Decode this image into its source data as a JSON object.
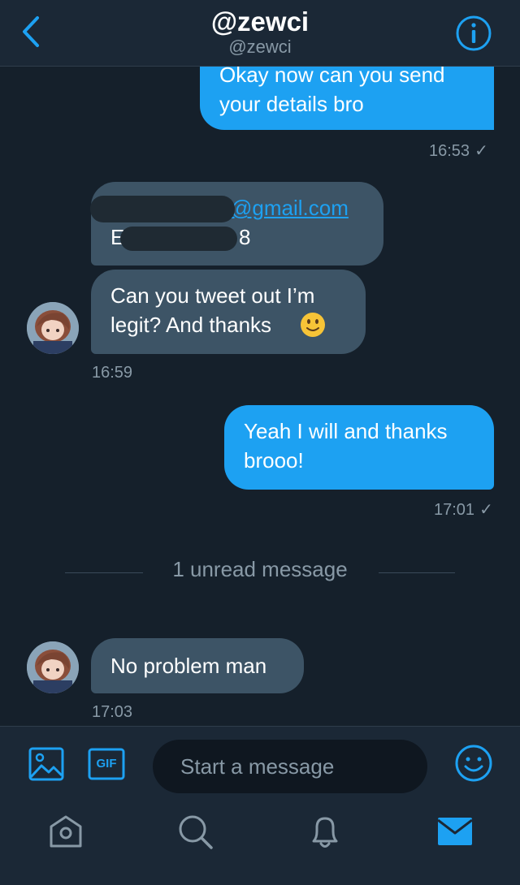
{
  "header": {
    "title": "@zewci",
    "subtitle": "@zewci",
    "back_icon": "chevron-left-icon",
    "info_icon": "info-icon"
  },
  "messages": {
    "m1": {
      "lines": [
        "Okay now can you send",
        "your details bro"
      ],
      "time": "16:53",
      "status": "✓"
    },
    "m2": {
      "email_suffix": "@gmail.com",
      "line2_start": "E",
      "line2_end": "8"
    },
    "m3": {
      "lines": [
        "Can you tweet out I’m",
        "legit? And thanks"
      ],
      "time": "16:59"
    },
    "m4": {
      "lines": [
        "Yeah I will and thanks",
        "brooo!"
      ],
      "time": "17:01",
      "status": "✓"
    },
    "unread": "1 unread message",
    "m5": {
      "text": "No problem man",
      "time": "17:03"
    }
  },
  "composer": {
    "placeholder": "Start a message",
    "gif_label": "GIF",
    "media_icon": "image-icon",
    "emoji_icon": "smiley-icon"
  },
  "tabs": [
    "home-icon",
    "search-icon",
    "bell-icon",
    "mail-icon"
  ],
  "colors": {
    "accent": "#1da1f2",
    "background": "#15202b",
    "bar": "#1b2836",
    "received_bubble": "#3d5466",
    "muted": "#8899a6"
  }
}
